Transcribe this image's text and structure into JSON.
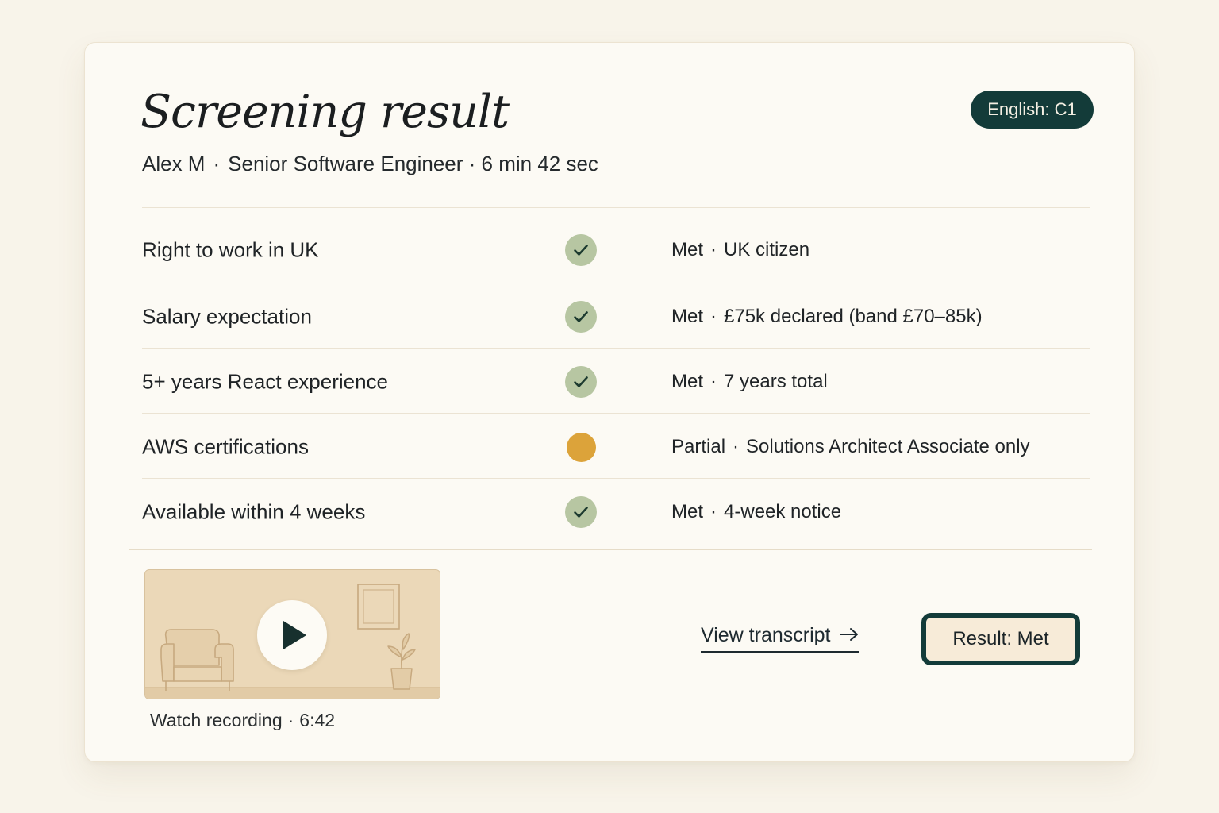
{
  "header": {
    "title": "Screening result",
    "candidate_name": "Alex M",
    "subtitle_separator": "·",
    "role_and_duration": "Senior Software Engineer · 6 min 42 sec",
    "language_badge": "English: C1"
  },
  "criteria": [
    {
      "label": "Right to work in UK",
      "status": "met",
      "status_label": "Met",
      "separator": "·",
      "detail": "UK citizen"
    },
    {
      "label": "Salary expectation",
      "status": "met",
      "status_label": "Met",
      "separator": "·",
      "detail": "£75k declared (band £70–85k)"
    },
    {
      "label": "5+ years React experience",
      "status": "met",
      "status_label": "Met",
      "separator": "·",
      "detail": "7 years total"
    },
    {
      "label": "AWS certifications",
      "status": "partial",
      "status_label": "Partial",
      "separator": "·",
      "detail": "Solutions Architect Associate only"
    },
    {
      "label": "Available within 4 weeks",
      "status": "met",
      "status_label": "Met",
      "separator": "·",
      "detail": "4-week notice"
    }
  ],
  "recording": {
    "label": "Watch recording",
    "separator": "·",
    "duration": "6:42",
    "play_icon": "play-icon"
  },
  "actions": {
    "transcript_label": "View transcript",
    "transcript_icon": "arrow-right-icon",
    "result_label": "Result: Met"
  },
  "colors": {
    "accent_dark_teal": "#133b39",
    "met_green": "#b7c6a2",
    "partial_amber": "#dca33a",
    "card_background": "#fcfaf4",
    "page_background": "#f8f4ea"
  }
}
